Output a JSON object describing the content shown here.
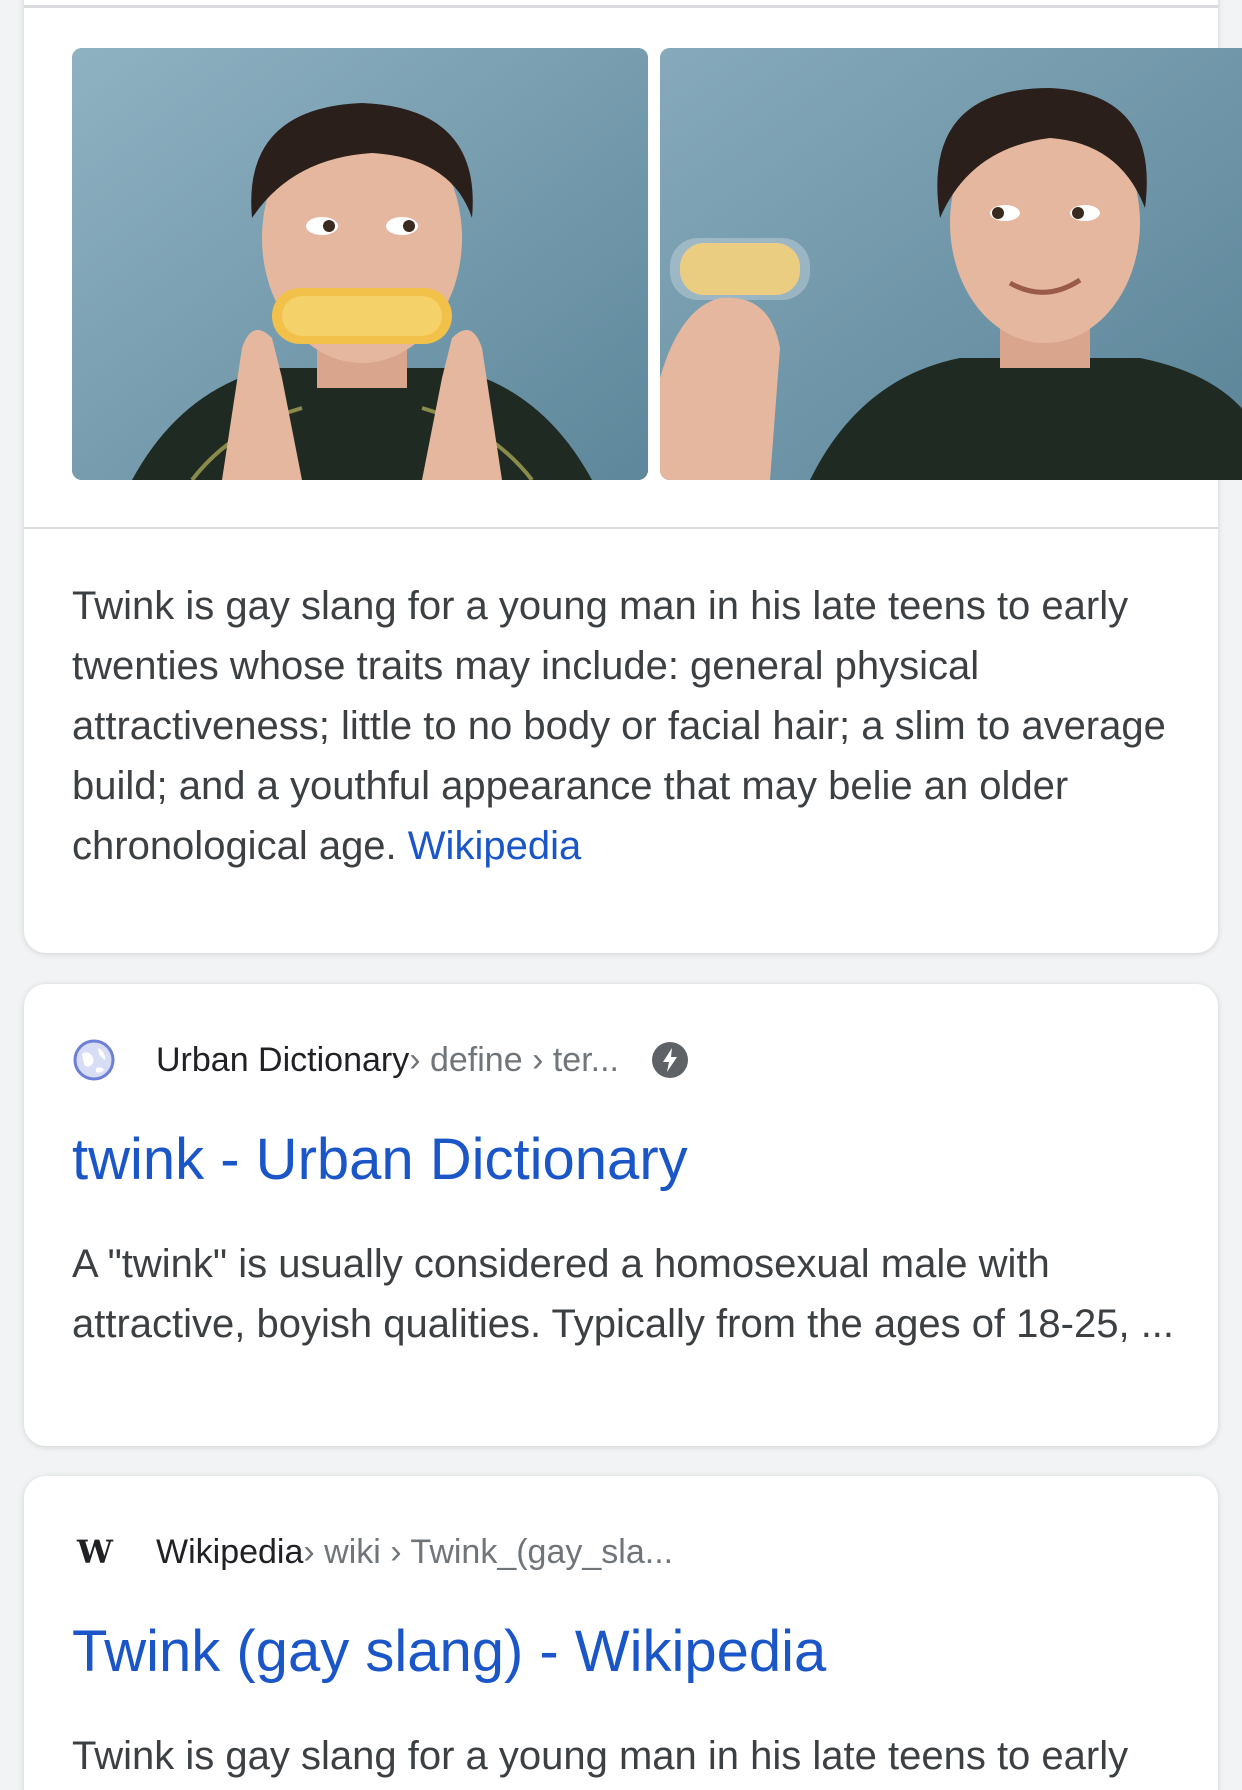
{
  "knowledge_panel": {
    "images": [
      {
        "alt": "young man holding a snack cake like a mustache"
      },
      {
        "alt": "young man smiling holding a snack cake"
      }
    ],
    "description": "Twink is gay slang for a young man in his late teens to early twenties whose traits may include: general physical attractiveness; little to no body or facial hair; a slim to average build; and a youthful appearance that may belie an older chronological age.",
    "source_link": "Wikipedia"
  },
  "results": [
    {
      "favicon": "globe-icon",
      "site": "Urban Dictionary",
      "path": " › define › ter...",
      "amp": "amp-bolt-icon",
      "title": "twink - Urban Dictionary",
      "snippet": "A \"twink\" is usually considered a homosexual male with attractive, boyish qualities. Typically from the ages of 18-25, ..."
    },
    {
      "favicon": "wikipedia-icon",
      "favicon_text": "W",
      "site": "Wikipedia",
      "path": " › wiki › Twink_(gay_sla...",
      "title": "Twink (gay slang) - Wikipedia",
      "snippet": "Twink is gay slang for a young man in his late teens to early twenties. The definition of twink has changed over time"
    }
  ],
  "colors": {
    "link": "#1a56c8",
    "text": "#3c4043",
    "path": "#70757a",
    "background": "#f1f3f4"
  }
}
